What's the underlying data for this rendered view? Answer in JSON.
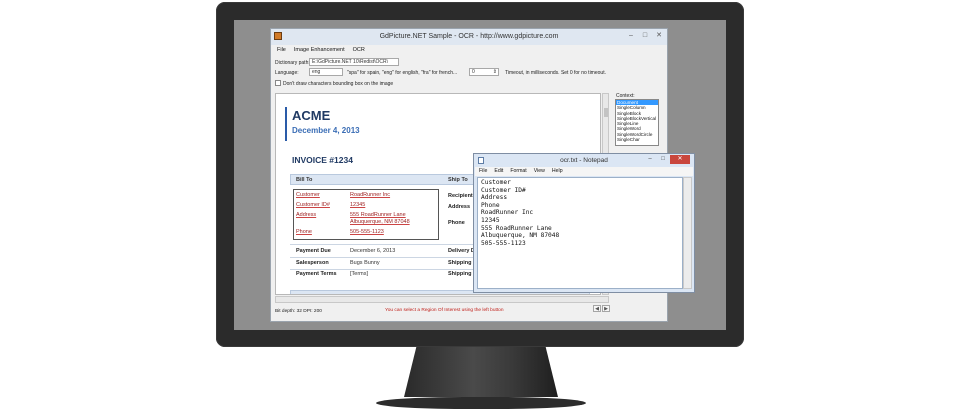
{
  "window": {
    "title": "GdPicture.NET Sample - OCR - http://www.gdpicture.com",
    "menu": [
      "File",
      "Image Enhancement",
      "OCR"
    ]
  },
  "form": {
    "dictionary_label": "Dictionary path:",
    "dictionary_value": "E:\\GdPicture.NET 10\\Redist\\OCR\\",
    "language_label": "Language:",
    "language_value": "eng",
    "language_hint": "\"spa\" for spain, \"eng\" for english, \"fra\" for french...",
    "timeout_value": "0",
    "timeout_hint": "Timeout, in milliseconds. Set 0 for no timeout.",
    "checkbox_label": "Don't draw characters bounding box on the image",
    "context_label": "Context:",
    "context_options": [
      "Document",
      "SingleColumn",
      "SingleBlock",
      "SingleBlockVertical",
      "SingleLine",
      "SingleWord",
      "SingleWordCircle",
      "SingleChar"
    ]
  },
  "document": {
    "company": "ACME",
    "date": "December 4, 2013",
    "invoice": "INVOICE #1234",
    "bill_to": "Bill To",
    "ship_to": "Ship To",
    "bill_fields": [
      {
        "label": "Customer",
        "value": "RoadRunner Inc"
      },
      {
        "label": "Customer ID#",
        "value": "12345"
      },
      {
        "label": "Address",
        "value": "555 RoadRunner Lane"
      },
      {
        "label": "",
        "value": "Albuquerque, NM 87048"
      },
      {
        "label": "Phone",
        "value": "505-555-1123"
      }
    ],
    "ship_fields": [
      "Recipient",
      "Address",
      "Phone"
    ],
    "terms": [
      {
        "label": "Payment Due",
        "value": "December 6, 2013"
      },
      {
        "label": "Salesperson",
        "value": "Bugs Bunny"
      },
      {
        "label": "Payment Terms",
        "value": "[Terms]"
      }
    ],
    "delivery_labels": [
      "Delivery Da",
      "Shipping M",
      "Shipping Te"
    ]
  },
  "status": {
    "bit_depth": "Bit depth:   32 DPI:   200",
    "message": "You can select a Region Of Interest using the left button"
  },
  "notepad": {
    "title": "ocr.txt - Notepad",
    "menu": [
      "File",
      "Edit",
      "Format",
      "View",
      "Help"
    ],
    "lines": [
      "Customer",
      "Customer ID#",
      "Address",
      "Phone",
      "RoadRunner Inc",
      "12345",
      "555 RoadRunner Lane",
      "Albuquerque, NM 87048",
      "505-555-1123"
    ]
  }
}
